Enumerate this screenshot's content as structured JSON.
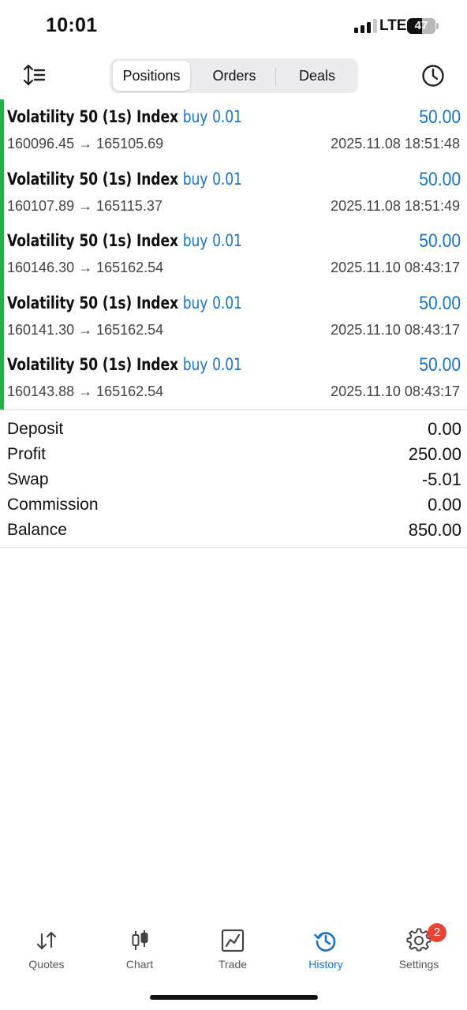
{
  "status_bar": {
    "time": "10:01",
    "network": "LTE",
    "battery": "47"
  },
  "toolbar": {
    "tabs": [
      {
        "label": "Positions",
        "active": true
      },
      {
        "label": "Orders",
        "active": false
      },
      {
        "label": "Deals",
        "active": false
      }
    ]
  },
  "positions": [
    {
      "symbol": "Volatility 50 (1s) Index",
      "side": "buy",
      "volume": "0.01",
      "profit": "50.00",
      "prices": "160096.45 → 165105.69",
      "time": "2025.11.08 18:51:48"
    },
    {
      "symbol": "Volatility 50 (1s) Index",
      "side": "buy",
      "volume": "0.01",
      "profit": "50.00",
      "prices": "160107.89 → 165115.37",
      "time": "2025.11.08 18:51:49"
    },
    {
      "symbol": "Volatility 50 (1s) Index",
      "side": "buy",
      "volume": "0.01",
      "profit": "50.00",
      "prices": "160146.30 → 165162.54",
      "time": "2025.11.10 08:43:17"
    },
    {
      "symbol": "Volatility 50 (1s) Index",
      "side": "buy",
      "volume": "0.01",
      "profit": "50.00",
      "prices": "160141.30 → 165162.54",
      "time": "2025.11.10 08:43:17"
    },
    {
      "symbol": "Volatility 50 (1s) Index",
      "side": "buy",
      "volume": "0.01",
      "profit": "50.00",
      "prices": "160143.88 → 165162.54",
      "time": "2025.11.10 08:43:17"
    }
  ],
  "summary": {
    "deposit": {
      "label": "Deposit",
      "value": "0.00"
    },
    "profit": {
      "label": "Profit",
      "value": "250.00"
    },
    "swap": {
      "label": "Swap",
      "value": "-5.01"
    },
    "commission": {
      "label": "Commission",
      "value": "0.00"
    },
    "balance": {
      "label": "Balance",
      "value": "850.00"
    }
  },
  "tabbar": {
    "quotes": "Quotes",
    "chart": "Chart",
    "trade": "Trade",
    "history": "History",
    "settings": "Settings",
    "settings_badge": "2",
    "active": "History"
  },
  "colors": {
    "accent_blue": "#1a73c7",
    "profit_bar_green": "#22b14c",
    "badge_red": "#ea4335"
  },
  "icons": {
    "sort": "sort-lines-icon",
    "clock": "clock-icon",
    "quotes": "quotes-arrows-icon",
    "chart": "candlestick-icon",
    "trade": "trade-chart-icon",
    "history": "history-icon",
    "settings": "gear-icon"
  }
}
